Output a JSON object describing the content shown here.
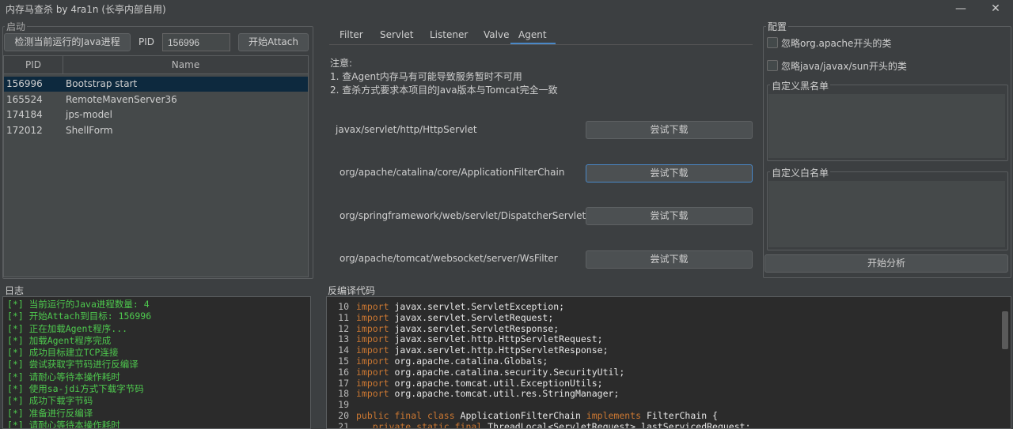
{
  "window": {
    "title": "内存马查杀  by 4ra1n (长亭内部自用)",
    "minimize_glyph": "—",
    "close_glyph": "✕"
  },
  "startup": {
    "group_label": "启动",
    "detect_button": "检测当前运行的Java进程",
    "pid_label": "PID",
    "pid_value": "156996",
    "attach_button": "开始Attach",
    "columns": [
      "PID",
      "Name"
    ],
    "rows": [
      {
        "pid": "156996",
        "name": "Bootstrap start",
        "selected": true
      },
      {
        "pid": "165524",
        "name": "RemoteMavenServer36",
        "selected": false
      },
      {
        "pid": "174184",
        "name": "jps-model",
        "selected": false
      },
      {
        "pid": "172012",
        "name": "ShellForm",
        "selected": false
      }
    ]
  },
  "tabs": [
    "Filter",
    "Servlet",
    "Listener",
    "Valve",
    "Agent"
  ],
  "active_tab": "Agent",
  "agent": {
    "notes_title": "注意:",
    "note1": "1. 查Agent内存马有可能导致服务暂时不可用",
    "note2": "2. 查杀方式要求本项目的Java版本与Tomcat完全一致",
    "targets": [
      {
        "class": "javax/servlet/http/HttpServlet",
        "button": "尝试下载"
      },
      {
        "class": "org/apache/catalina/core/ApplicationFilterChain",
        "button": "尝试下载"
      },
      {
        "class": "org/springframework/web/servlet/DispatcherServlet",
        "button": "尝试下载"
      },
      {
        "class": "org/apache/tomcat/websocket/server/WsFilter",
        "button": "尝试下载"
      }
    ]
  },
  "config": {
    "group_label": "配置",
    "ignore_apache": "忽略org.apache开头的类",
    "ignore_java": "忽略java/javax/sun开头的类",
    "blacklist_label": "自定义黑名单",
    "whitelist_label": "自定义白名单",
    "analyze_button": "开始分析"
  },
  "log": {
    "label": "日志",
    "lines": [
      "[*] 当前运行的Java进程数量: 4",
      "[*] 开始Attach到目标: 156996",
      "[*] 正在加载Agent程序...",
      "[*] 加载Agent程序完成",
      "[*] 成功目标建立TCP连接",
      "[*] 尝试获取字节码进行反编译",
      "[*] 请耐心等待本操作耗时",
      "[*] 使用sa-jdi方式下载字节码",
      "[*] 成功下载字节码",
      "[*] 准备进行反编译",
      "[*] 请耐心等待本操作耗时"
    ]
  },
  "decompile": {
    "label": "反编译代码",
    "lines": [
      {
        "n": "10",
        "kw": "import",
        "rest": " javax.servlet.ServletException;"
      },
      {
        "n": "11",
        "kw": "import",
        "rest": " javax.servlet.ServletRequest;"
      },
      {
        "n": "12",
        "kw": "import",
        "rest": " javax.servlet.ServletResponse;"
      },
      {
        "n": "13",
        "kw": "import",
        "rest": " javax.servlet.http.HttpServletRequest;"
      },
      {
        "n": "14",
        "kw": "import",
        "rest": " javax.servlet.http.HttpServletResponse;"
      },
      {
        "n": "15",
        "kw": "import",
        "rest": " org.apache.catalina.Globals;"
      },
      {
        "n": "16",
        "kw": "import",
        "rest": " org.apache.catalina.security.SecurityUtil;"
      },
      {
        "n": "17",
        "kw": "import",
        "rest": " org.apache.tomcat.util.ExceptionUtils;"
      },
      {
        "n": "18",
        "kw": "import",
        "rest": " org.apache.tomcat.util.res.StringManager;"
      },
      {
        "n": "19",
        "kw": "",
        "rest": ""
      },
      {
        "n": "20",
        "kw": "public final class",
        "rest": " ApplicationFilterChain ",
        "kw2": "implements",
        "rest2": " FilterChain {"
      },
      {
        "n": "21",
        "kw": "   private static final",
        "rest": " ThreadLocal<ServletRequest> lastServicedRequest;"
      }
    ]
  }
}
